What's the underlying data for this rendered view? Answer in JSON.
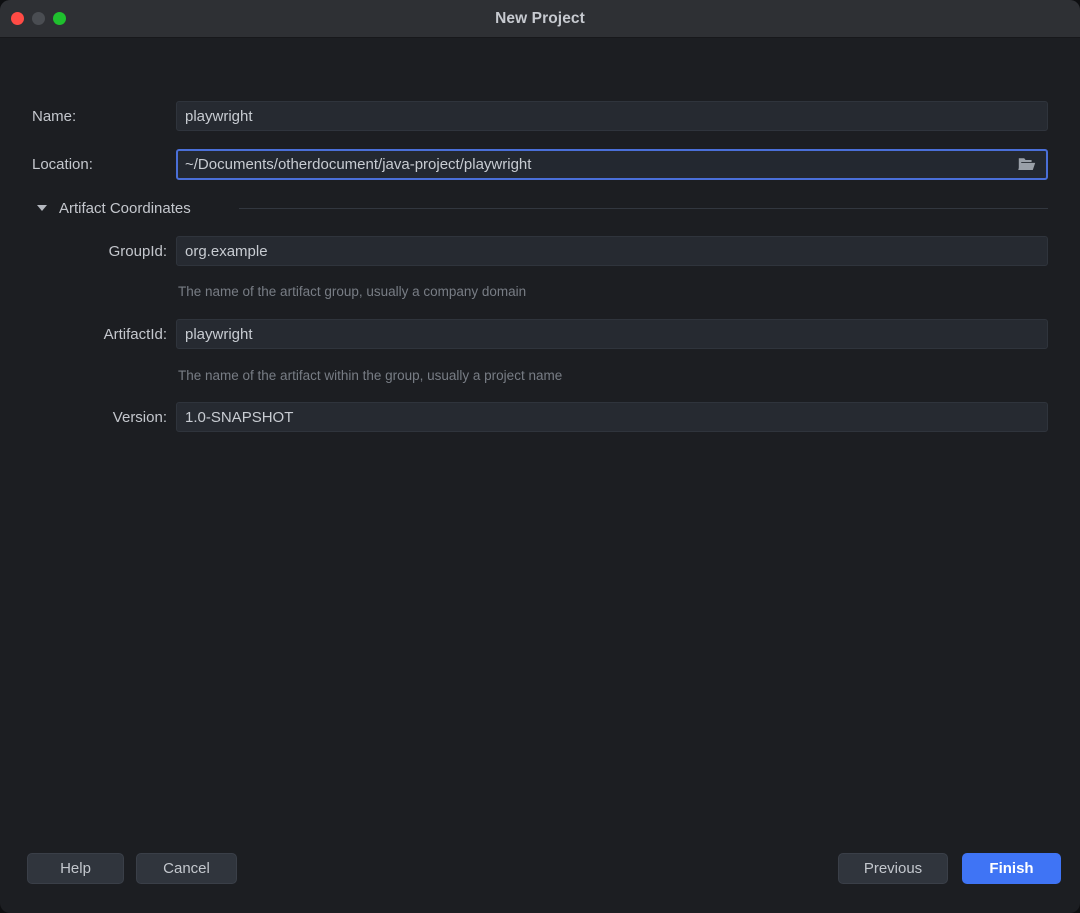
{
  "window": {
    "title": "New Project",
    "traffic_lights": [
      {
        "name": "close",
        "color": "#ff4b45"
      },
      {
        "name": "minimize",
        "color": "#4a4d52"
      },
      {
        "name": "zoom",
        "color": "#1fc02e"
      }
    ]
  },
  "form": {
    "name": {
      "label": "Name:",
      "value": "playwright"
    },
    "location": {
      "label": "Location:",
      "value": "~/Documents/otherdocument/java-project/playwright",
      "focused": true,
      "browse_icon": "folder-icon"
    }
  },
  "section": {
    "title": "Artifact Coordinates",
    "expanded": true,
    "disclosure_icon": "chevron-down-icon",
    "fields": {
      "group_id": {
        "label": "GroupId:",
        "value": "org.example",
        "helper": "The name of the artifact group, usually a company domain"
      },
      "artifact_id": {
        "label": "ArtifactId:",
        "value": "playwright",
        "helper": "The name of the artifact within the group, usually a project name"
      },
      "version": {
        "label": "Version:",
        "value": "1.0-SNAPSHOT"
      }
    }
  },
  "footer": {
    "help": "Help",
    "cancel": "Cancel",
    "previous": "Previous",
    "finish": "Finish"
  },
  "colors": {
    "titlebar": "#2e3034",
    "background": "#1c1e22",
    "input_background": "#262a31",
    "focus_border": "#4a6fd8",
    "primary_button": "#3f74f5",
    "label_text": "#c4c7cd",
    "helper_text": "#787d85"
  }
}
